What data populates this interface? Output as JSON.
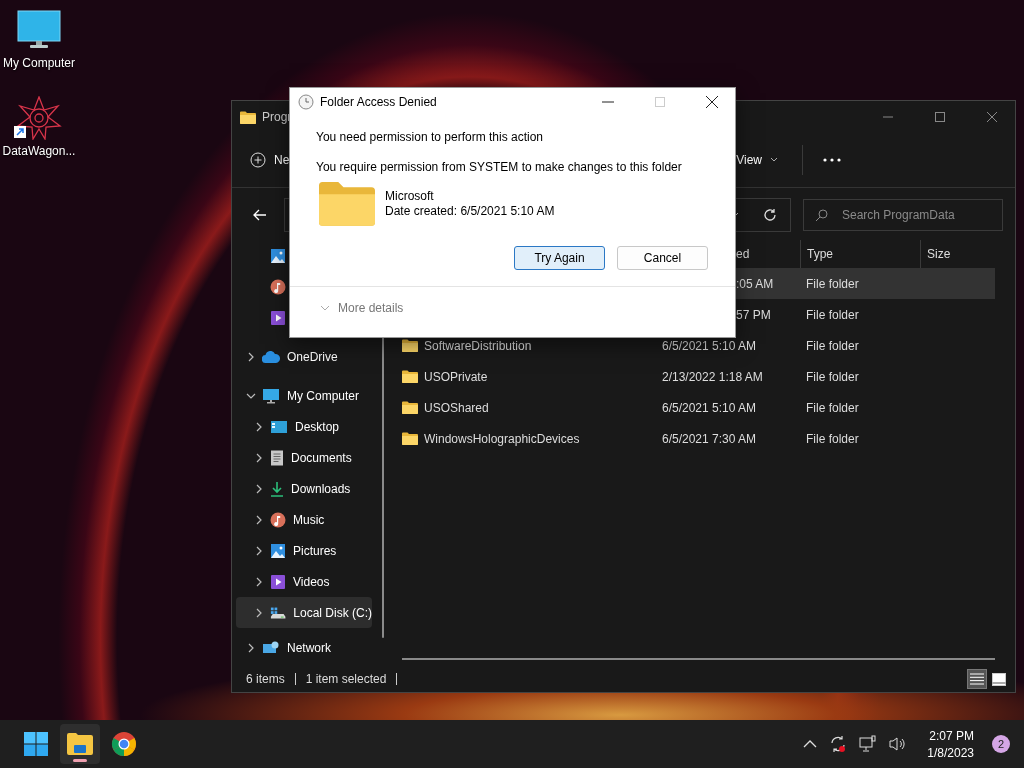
{
  "desktop_icons": [
    {
      "label": "My Computer",
      "kind": "computer"
    },
    {
      "label": "DataWagon...",
      "kind": "shortcut"
    }
  ],
  "explorer": {
    "title": "Progr",
    "toolbar": {
      "new_label": "Ne",
      "view_label": "View"
    },
    "search": {
      "placeholder": "Search ProgramData"
    },
    "sidebar": [
      {
        "kind": "pictures",
        "selected": false
      },
      {
        "kind": "music",
        "selected": false
      },
      {
        "kind": "videos",
        "selected": false
      },
      {
        "label": "OneDrive",
        "kind": "cloud",
        "expanded": false,
        "selected": false
      },
      {
        "label": "My Computer",
        "kind": "computer",
        "expanded": true,
        "selected": false,
        "children": [
          {
            "label": "Desktop",
            "kind": "desktop",
            "expanded": false,
            "selected": false
          },
          {
            "label": "Documents",
            "kind": "documents",
            "expanded": false,
            "selected": false
          },
          {
            "label": "Downloads",
            "kind": "downloads",
            "expanded": false,
            "selected": false
          },
          {
            "label": "Music",
            "kind": "music",
            "expanded": false,
            "selected": false
          },
          {
            "label": "Pictures",
            "kind": "pictures",
            "expanded": false,
            "selected": false
          },
          {
            "label": "Videos",
            "kind": "videos",
            "expanded": false,
            "selected": false
          },
          {
            "label": "Local Disk (C:)",
            "kind": "disk",
            "expanded": false,
            "selected": true
          }
        ]
      },
      {
        "label": "Network",
        "kind": "network",
        "expanded": false,
        "selected": false
      }
    ],
    "columns": [
      "ed",
      "Type",
      "Size"
    ],
    "rows": [
      {
        "date": ":05 AM",
        "type": "File folder",
        "selected": true
      },
      {
        "date": "57 PM",
        "type": "File folder",
        "selected": false
      },
      {
        "name": "SoftwareDistribution",
        "date": "6/5/2021 5:10 AM",
        "type": "File folder",
        "selected": false
      },
      {
        "name": "USOPrivate",
        "date": "2/13/2022 1:18 AM",
        "type": "File folder",
        "selected": false
      },
      {
        "name": "USOShared",
        "date": "6/5/2021 5:10 AM",
        "type": "File folder",
        "selected": false
      },
      {
        "name": "WindowsHolographicDevices",
        "date": "6/5/2021 7:30 AM",
        "type": "File folder",
        "selected": false
      }
    ],
    "status_bar": {
      "item_count": "6 items",
      "selection": "1 item selected"
    },
    "view_buttons": [
      {
        "kind": "details",
        "selected": true
      },
      {
        "kind": "tiles",
        "selected": false
      }
    ]
  },
  "dialog": {
    "title": "Folder Access Denied",
    "heading": "You need permission to perform this action",
    "message": "You require permission from SYSTEM to make changes to this folder",
    "folder_name": "Microsoft",
    "date_created": "Date created: 6/5/2021 5:10 AM",
    "buttons": [
      {
        "label": "Try Again",
        "selected": true
      },
      {
        "label": "Cancel",
        "selected": false
      }
    ],
    "more_details": "More details"
  },
  "taskbar": {
    "apps": [
      {
        "kind": "start",
        "active": false
      },
      {
        "kind": "explorer",
        "active": true
      },
      {
        "kind": "browser",
        "active": false
      }
    ],
    "time": "2:07 PM",
    "date": "1/8/2023",
    "notifications": "2"
  }
}
